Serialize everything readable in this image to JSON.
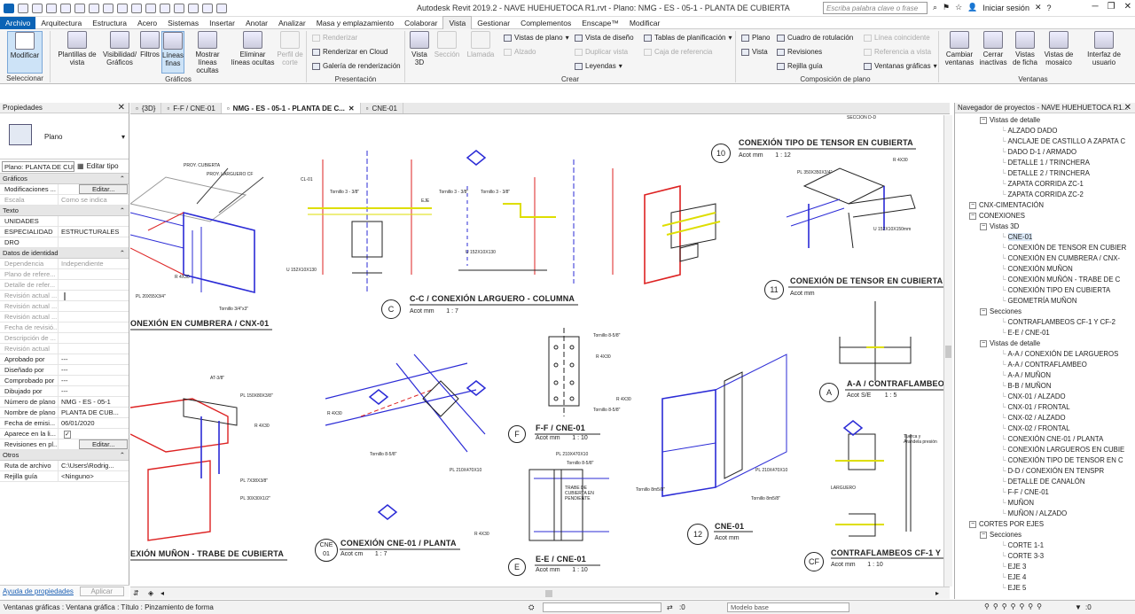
{
  "title": "Autodesk Revit 2019.2 - NAVE HUEHUETOCA R1.rvt - Plano: NMG - ES - 05-1 - PLANTA DE CUBIERTA",
  "search_placeholder": "Escriba palabra clave o frase",
  "signin": "Iniciar sesión",
  "menu_tabs": [
    "Archivo",
    "Arquitectura",
    "Estructura",
    "Acero",
    "Sistemas",
    "Insertar",
    "Anotar",
    "Analizar",
    "Masa y emplazamiento",
    "Colaborar",
    "Vista",
    "Gestionar",
    "Complementos",
    "Enscape™",
    "Modificar"
  ],
  "ribbon": {
    "modificar": "Modificar",
    "seleccionar": "Seleccionar",
    "plantillas": "Plantillas de vista",
    "visibilidad": "Visibilidad/ Gráficos",
    "filtros": "Filtros",
    "lineas_finas": "Líneas finas",
    "mostrar": "Mostrar líneas ocultas",
    "eliminar": "Eliminar líneas ocultas",
    "perfil": "Perfil de corte",
    "graficos": "Gráficos",
    "renderizar": "Renderizar",
    "renderizar_nube": "Renderizar en Cloud",
    "galeria": "Galería de renderización",
    "presentacion": "Presentación",
    "vista3d": "Vista 3D",
    "seccion": "Sección",
    "llamada": "Llamada",
    "vistas_plano": "Vistas de plano",
    "alzado": "Alzado",
    "vista_diseno": "Vista de diseño",
    "duplicar": "Duplicar vista",
    "leyendas": "Leyendas",
    "tablas": "Tablas de planificación",
    "caja": "Caja de referencia",
    "crear": "Crear",
    "plano": "Plano",
    "vista": "Vista",
    "cuadro": "Cuadro de rotulación",
    "revisiones": "Revisiones",
    "rejilla": "Rejilla guía",
    "linea_coinc": "Línea coincidente",
    "ref_vista": "Referencia a vista",
    "ventanas_graf": "Ventanas gráficas",
    "composicion": "Composición de plano",
    "cambiar": "Cambiar ventanas",
    "cerrar": "Cerrar inactivas",
    "ficha": "Vistas de ficha",
    "mosaico": "Vistas de mosaico",
    "interfaz": "Interfaz de usuario",
    "ventanas": "Ventanas"
  },
  "properties": {
    "header": "Propiedades",
    "type_name": "Plano",
    "selector": "Plano: PLANTA DE CUBIERTA",
    "edit_type": "Editar tipo",
    "categories": {
      "graficos": "Gráficos",
      "texto": "Texto",
      "datos": "Datos de identidad",
      "otros": "Otros"
    },
    "rows_graficos": [
      {
        "k": "Modificaciones ...",
        "v": "",
        "btn": "Editar..."
      },
      {
        "k": "Escala",
        "v": "Como se indica",
        "gray": true
      }
    ],
    "rows_texto": [
      {
        "k": "UNIDADES",
        "v": ""
      },
      {
        "k": "ESPECIALIDAD",
        "v": "ESTRUCTURALES"
      },
      {
        "k": "DRO",
        "v": ""
      }
    ],
    "rows_datos": [
      {
        "k": "Dependencia",
        "v": "Independiente",
        "gray": true
      },
      {
        "k": "Plano de refere...",
        "v": "",
        "gray": true
      },
      {
        "k": "Detalle de refer...",
        "v": "",
        "gray": true
      },
      {
        "k": "Revisión actual ...",
        "v": "",
        "gray": true,
        "chk": true
      },
      {
        "k": "Revisión actual ...",
        "v": "",
        "gray": true
      },
      {
        "k": "Revisión actual ...",
        "v": "",
        "gray": true
      },
      {
        "k": "Fecha de revisió...",
        "v": "",
        "gray": true
      },
      {
        "k": "Descripción de ...",
        "v": "",
        "gray": true
      },
      {
        "k": "Revisión actual",
        "v": "",
        "gray": true
      },
      {
        "k": "Aprobado por",
        "v": "---"
      },
      {
        "k": "Diseñado por",
        "v": "---"
      },
      {
        "k": "Comprobado por",
        "v": "---"
      },
      {
        "k": "Dibujado por",
        "v": "---"
      },
      {
        "k": "Número de plano",
        "v": "NMG - ES - 05-1"
      },
      {
        "k": "Nombre de plano",
        "v": "PLANTA DE CUB..."
      },
      {
        "k": "Fecha de emisi...",
        "v": "06/01/2020"
      },
      {
        "k": "Aparece en la li...",
        "v": "",
        "chk": true,
        "checked": true
      },
      {
        "k": "Revisiones en pl...",
        "v": "",
        "btn": "Editar..."
      }
    ],
    "rows_otros": [
      {
        "k": "Ruta de archivo",
        "v": "C:\\Users\\Rodrig..."
      },
      {
        "k": "Rejilla guía",
        "v": "<Ninguno>"
      }
    ],
    "help_link": "Ayuda de propiedades",
    "apply": "Aplicar"
  },
  "view_tabs": [
    "{3D}",
    "F-F / CNE-01",
    "NMG - ES - 05-1 - PLANTA DE C...",
    "CNE-01"
  ],
  "drawing": {
    "titles": [
      "CONEXIÓN TIPO DE TENSOR EN CUBIERTA",
      "CONEXIÓN DE TENSOR EN CUBIERTA",
      "C-C / CONEXIÓN LARGUERO - COLUMNA",
      "ONEXIÓN EN CUMBRERA / CNX-01",
      "A-A / CONTRAFLAMBEO",
      "F-F / CNE-01",
      "CONEXIÓN CNE-01 / PLANTA",
      "EXIÓN MUÑON - TRABE DE CUBIERTA",
      "E-E / CNE-01",
      "CNE-01",
      "CONTRAFLAMBEOS CF-1 Y CF-2"
    ],
    "bubbles": [
      "10",
      "11",
      "C",
      "A",
      "F",
      "CNE 01",
      "E",
      "12",
      "CF"
    ],
    "subs": [
      "Acot mm       1 : 12",
      "Acot mm",
      "Acot mm       1 : 7",
      "Acot S/E        1 : 5",
      "Acot mm       1 : 10",
      "Acot cm       1 : 7",
      "Acot mm       1 : 10",
      "Acot mm",
      "Acot mm       1 : 10"
    ],
    "notes": [
      "PROY. CUBIERTA",
      "PROY. LARGUERO CF",
      "PL 20X55X3/4\"",
      "Tornillo 3/4\"x3\"",
      "R 4X30",
      "CL-01",
      "Tornillo 3 - 3/8\"",
      "U 152X10X130",
      "Tornillo 3 - 3/8\"",
      "EJE",
      "Tornillo 3 - 3/8\"",
      "U 152X10X130",
      "PL 350X350X3/4\"",
      "U 152X10X150mm",
      "R 4X30",
      "Tornillo 8-5/8\"",
      "R 4X30",
      "Tornillo 8-5/8\"",
      "Tornillo 8m5/8\"",
      "R 4X30",
      "PL 210X470X10",
      "Tornillo 8m5/8\"",
      "AT-3/8\"",
      "PL 150X80X3/8\"",
      "R 4X30",
      "PL 7X38X3/8\"",
      "PL 30X30X1/2\"",
      "R 4X30",
      "Tornillo 8-5/8\"",
      "PL 210X470X10",
      "R 4X30",
      "PL 210X470X10",
      "Tornillo 8-5/8\"",
      "LARGUERO",
      "TRABE DE CUBIERTA EN PENDIENTE",
      "Tuerca y Arandela presión",
      "SECCION D-D"
    ]
  },
  "project_browser": {
    "header": "Navegador de proyectos - NAVE HUEHUETOCA R1...",
    "nodes": [
      {
        "lvl": 2,
        "t": "Vistas de detalle",
        "ex": "-"
      },
      {
        "lvl": 4,
        "t": "ALZADO DADO"
      },
      {
        "lvl": 4,
        "t": "ANCLAJE DE CASTILLO A ZAPATA C"
      },
      {
        "lvl": 4,
        "t": "DADO D-1 / ARMADO"
      },
      {
        "lvl": 4,
        "t": "DETALLE 1 / TRINCHERA"
      },
      {
        "lvl": 4,
        "t": "DETALLE 2 / TRINCHERA"
      },
      {
        "lvl": 4,
        "t": "ZAPATA CORRIDA ZC-1"
      },
      {
        "lvl": 4,
        "t": "ZAPATA CORRIDA ZC-2"
      },
      {
        "lvl": 1,
        "t": "CNX-CIMENTACIÓN",
        "ex": "-"
      },
      {
        "lvl": 1,
        "t": "CONEXIONES",
        "ex": "-"
      },
      {
        "lvl": 2,
        "t": "Vistas 3D",
        "ex": "-"
      },
      {
        "lvl": 4,
        "t": "CNE-01",
        "sel": true
      },
      {
        "lvl": 4,
        "t": "CONEXIÓN DE TENSOR EN CUBIER"
      },
      {
        "lvl": 4,
        "t": "CONEXIÓN EN CUMBRERA / CNX-"
      },
      {
        "lvl": 4,
        "t": "CONEXIÓN MUÑON"
      },
      {
        "lvl": 4,
        "t": "CONEXIÓN MUÑÓN - TRABE DE C"
      },
      {
        "lvl": 4,
        "t": "CONEXIÓN TIPO EN CUBIERTA"
      },
      {
        "lvl": 4,
        "t": "GEOMETRÍA MUÑON"
      },
      {
        "lvl": 2,
        "t": "Secciones",
        "ex": "-"
      },
      {
        "lvl": 4,
        "t": "CONTRAFLAMBEOS CF-1 Y CF-2"
      },
      {
        "lvl": 4,
        "t": "E-E / CNE-01"
      },
      {
        "lvl": 2,
        "t": "Vistas de detalle",
        "ex": "-"
      },
      {
        "lvl": 4,
        "t": "A-A / CONEXIÓN DE LARGUEROS"
      },
      {
        "lvl": 4,
        "t": "A-A / CONTRAFLAMBEO"
      },
      {
        "lvl": 4,
        "t": "A-A / MUÑON"
      },
      {
        "lvl": 4,
        "t": "B-B / MUÑON"
      },
      {
        "lvl": 4,
        "t": "CNX-01 / ALZADO"
      },
      {
        "lvl": 4,
        "t": "CNX-01 / FRONTAL"
      },
      {
        "lvl": 4,
        "t": "CNX-02 / ALZADO"
      },
      {
        "lvl": 4,
        "t": "CNX-02 / FRONTAL"
      },
      {
        "lvl": 4,
        "t": "CONEXIÓN CNE-01 / PLANTA"
      },
      {
        "lvl": 4,
        "t": "CONEXIÓN LARGUEROS EN CUBIE"
      },
      {
        "lvl": 4,
        "t": "CONEXIÓN TIPO DE TENSOR EN C"
      },
      {
        "lvl": 4,
        "t": "D-D / CONEXIÓN EN TENSPR"
      },
      {
        "lvl": 4,
        "t": "DETALLE DE CANALÓN"
      },
      {
        "lvl": 4,
        "t": "F-F / CNE-01"
      },
      {
        "lvl": 4,
        "t": "MUÑON"
      },
      {
        "lvl": 4,
        "t": "MUÑON / ALZADO"
      },
      {
        "lvl": 1,
        "t": "CORTES POR EJES",
        "ex": "-"
      },
      {
        "lvl": 2,
        "t": "Secciones",
        "ex": "-"
      },
      {
        "lvl": 4,
        "t": "CORTE 1-1"
      },
      {
        "lvl": 4,
        "t": "CORTE 3-3"
      },
      {
        "lvl": 4,
        "t": "EJE 3"
      },
      {
        "lvl": 4,
        "t": "EJE 4"
      },
      {
        "lvl": 4,
        "t": "EJE 5"
      }
    ]
  },
  "status": {
    "text": "Ventanas gráficas : Ventana gráfica : Título : Pinzamiento de forma",
    "coord": ":0",
    "model": "Modelo base",
    "filter": ":0"
  },
  "colors": {
    "accent": "#0b63b5",
    "steel_blue": "#2b2bd6",
    "red": "#d22",
    "yellow": "#e6e600"
  }
}
